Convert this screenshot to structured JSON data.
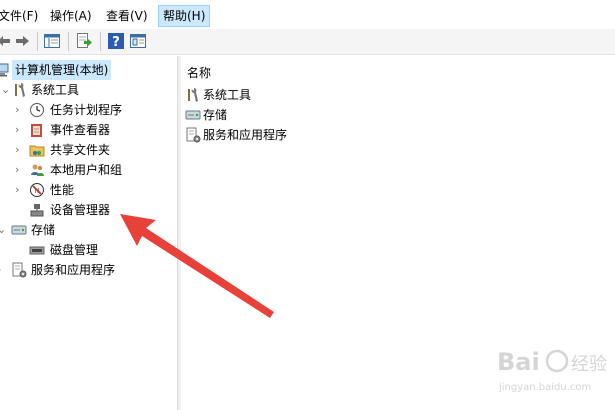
{
  "menu": {
    "items": [
      {
        "label": "文件(F)",
        "active": false
      },
      {
        "label": "操作(A)",
        "active": false
      },
      {
        "label": "查看(V)",
        "active": false
      },
      {
        "label": "帮助(H)",
        "active": true
      }
    ]
  },
  "toolbar": {
    "icons": [
      "back-arrow-icon",
      "forward-arrow-icon",
      "show-hide-tree-icon",
      "export-list-icon",
      "help-icon",
      "properties-icon"
    ]
  },
  "tree": {
    "root": "计算机管理(本地)",
    "system_tools": "系统工具",
    "task_scheduler": "任务计划程序",
    "event_viewer": "事件查看器",
    "shared_folders": "共享文件夹",
    "local_users": "本地用户和组",
    "performance": "性能",
    "device_manager": "设备管理器",
    "storage": "存储",
    "disk_management": "磁盘管理",
    "services_apps": "服务和应用程序"
  },
  "list": {
    "header": "名称",
    "items": [
      "系统工具",
      "存储",
      "服务和应用程序"
    ]
  },
  "annotation": {
    "arrow_color": "#e8413a"
  },
  "watermark": {
    "brand": "Bai",
    "sub": "jingyan.baidu.com"
  }
}
